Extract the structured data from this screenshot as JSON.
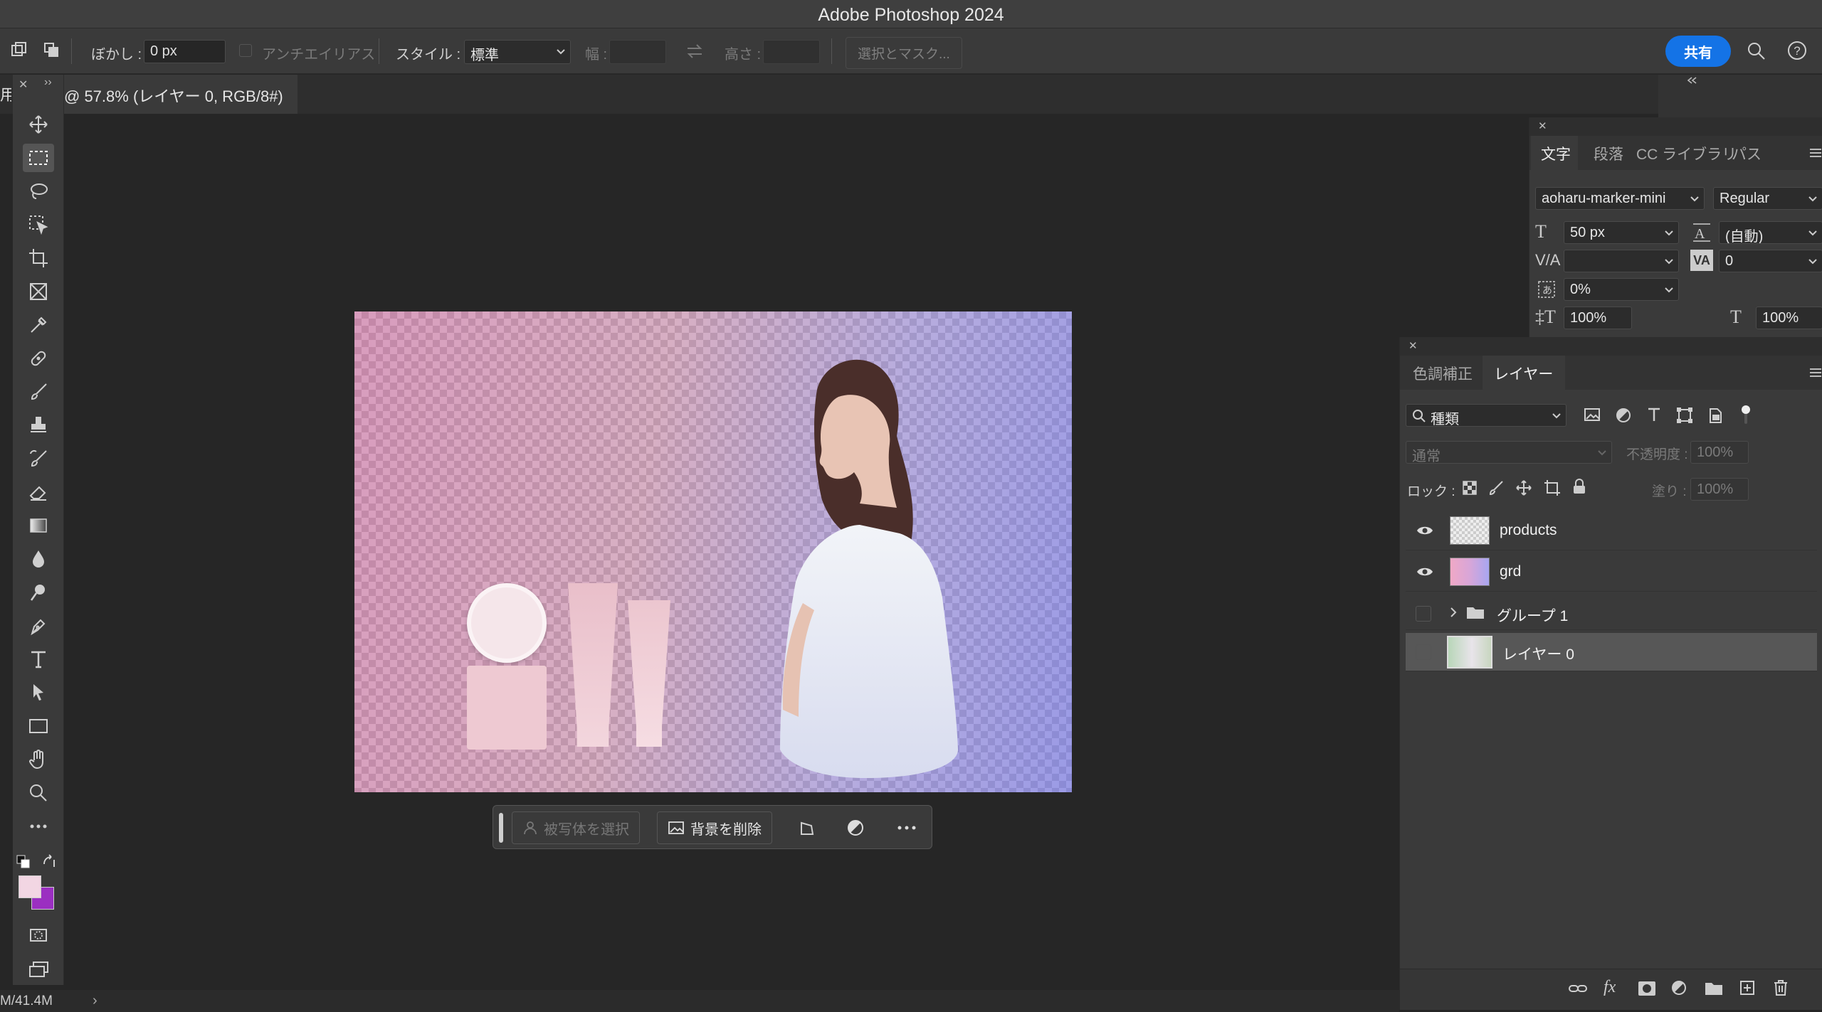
{
  "app": {
    "title": "Adobe Photoshop 2024"
  },
  "options_bar": {
    "feather_label": "ぼかし :",
    "feather_value": "0 px",
    "antialias_label": "アンチエイリアス",
    "style_label": "スタイル :",
    "style_value": "標準",
    "width_label": "幅 :",
    "height_label": "高さ :",
    "select_mask_label": "選択とマスク...",
    "share_label": "共有"
  },
  "document_tab": {
    "label": "@ 57.8% (レイヤー 0, RGB/8#)",
    "edge_char": "用"
  },
  "context_bar": {
    "select_subject_label": "被写体を選択",
    "remove_bg_label": "背景を削除"
  },
  "character_panel": {
    "tabs": [
      "文字",
      "段落",
      "CC ライブラリ",
      "パス"
    ],
    "active_tab": 0,
    "font_family": "aoharu-marker-mini",
    "font_style": "Regular",
    "font_size": "50 px",
    "leading": "(自動)",
    "kerning": "",
    "tracking": "0",
    "tsume": "0%",
    "vertical_scale": "100%",
    "horizontal_scale": "100%"
  },
  "layers_panel": {
    "tabs": [
      "色調補正",
      "レイヤー"
    ],
    "active_tab": 1,
    "filter_value": "種類",
    "blend_mode": "通常",
    "opacity_label": "不透明度 :",
    "opacity_value": "100%",
    "lock_label": "ロック :",
    "fill_label": "塗り :",
    "fill_value": "100%",
    "layers": [
      {
        "name": "products",
        "visible": true,
        "kind": "image"
      },
      {
        "name": "grd",
        "visible": true,
        "kind": "image"
      },
      {
        "name": "グループ 1",
        "visible": false,
        "kind": "group"
      },
      {
        "name": "レイヤー 0",
        "visible": false,
        "kind": "image",
        "selected": true
      }
    ]
  },
  "status_bar": {
    "doc_size": "M/41.4M"
  },
  "colors": {
    "accent_blue": "#1473e6",
    "foreground_swatch": "#f2d6e3",
    "background_swatch": "#9b2fc1",
    "selected_row": "#575757"
  }
}
